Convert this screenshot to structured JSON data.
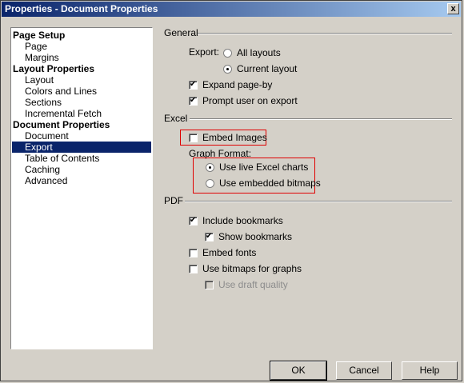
{
  "window": {
    "title": "Properties - Document Properties",
    "close_label": "x"
  },
  "tree": {
    "groups": [
      {
        "label": "Page Setup",
        "items": [
          "Page",
          "Margins"
        ]
      },
      {
        "label": "Layout Properties",
        "items": [
          "Layout",
          "Colors and Lines",
          "Sections",
          "Incremental Fetch"
        ]
      },
      {
        "label": "Document Properties",
        "items": [
          "Document",
          "Export",
          "Table of Contents",
          "Caching",
          "Advanced"
        ]
      }
    ],
    "selected": "Export"
  },
  "general": {
    "section_label": "General",
    "export_label": "Export:",
    "all_layouts": "All layouts",
    "current_layout": "Current layout",
    "expand_page_by": "Expand page-by",
    "prompt_user": "Prompt user on export"
  },
  "excel": {
    "section_label": "Excel",
    "embed_images": "Embed Images",
    "graph_format_label": "Graph Format:",
    "live_charts": "Use live Excel charts",
    "embedded_bitmaps": "Use embedded bitmaps"
  },
  "pdf": {
    "section_label": "PDF",
    "include_bookmarks": "Include bookmarks",
    "show_bookmarks": "Show bookmarks",
    "embed_fonts": "Embed fonts",
    "use_bitmaps": "Use bitmaps for graphs",
    "draft_quality": "Use draft quality"
  },
  "buttons": {
    "ok": "OK",
    "cancel": "Cancel",
    "help": "Help"
  },
  "colors": {
    "title_start": "#0a246a",
    "title_end": "#a6caf0",
    "highlight": "#e00000"
  }
}
